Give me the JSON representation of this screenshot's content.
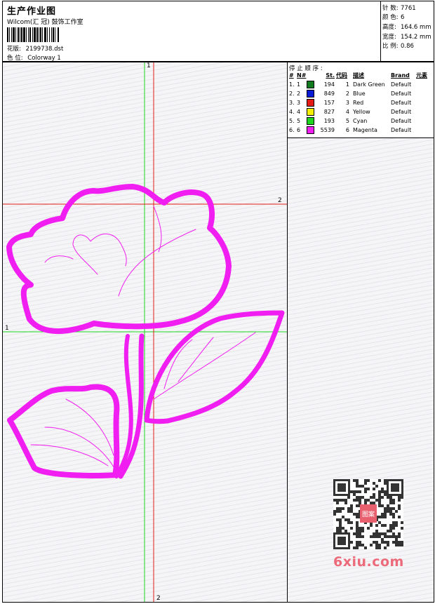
{
  "header": {
    "title": "生产作业图",
    "subtitle": "Wilcom(汇 冠) 鼓饰工作室",
    "design_label": "花版:",
    "design_file": "2199738.dst",
    "colorway_label": "色 位:",
    "colorway": "Colorway 1"
  },
  "stats": [
    {
      "label": "针 数:",
      "value": "7761"
    },
    {
      "label": "颜 色:",
      "value": "6"
    },
    {
      "label": "高度:",
      "value": "164.6 mm"
    },
    {
      "label": "宽度:",
      "value": "154.2 mm"
    },
    {
      "label": "比 例:",
      "value": "0.86"
    }
  ],
  "stop_sequence": {
    "title": "停 止 顺 序 :",
    "columns": [
      "#",
      "N#",
      "St.",
      "代码",
      "描述",
      "Brand",
      "元素"
    ],
    "rows": [
      {
        "num": "1.",
        "n": "1",
        "color": "#117a1e",
        "st": "194",
        "code": "1",
        "desc": "Dark Green",
        "brand": "Default"
      },
      {
        "num": "2.",
        "n": "2",
        "color": "#0a1bd6",
        "st": "849",
        "code": "2",
        "desc": "Blue",
        "brand": "Default"
      },
      {
        "num": "3.",
        "n": "3",
        "color": "#e41b14",
        "st": "157",
        "code": "3",
        "desc": "Red",
        "brand": "Default"
      },
      {
        "num": "4.",
        "n": "4",
        "color": "#f4f000",
        "st": "827",
        "code": "4",
        "desc": "Yellow",
        "brand": "Default"
      },
      {
        "num": "5.",
        "n": "5",
        "color": "#1ed61e",
        "st": "193",
        "code": "5",
        "desc": "Cyan",
        "brand": "Default"
      },
      {
        "num": "6.",
        "n": "6",
        "color": "#f01ef0",
        "st": "5539",
        "code": "6",
        "desc": "Magenta",
        "brand": "Default"
      }
    ]
  },
  "guides": {
    "green_vertical_label": "1",
    "green_horizontal_label": "1",
    "red_horizontal_label": "2",
    "red_vertical_label": "2"
  },
  "colors": {
    "design": "#f01ef0",
    "guide_green": "#1ed61e",
    "guide_red": "#e41b14"
  },
  "watermark": {
    "site": "6xiu.com",
    "seal_text": "图案"
  }
}
